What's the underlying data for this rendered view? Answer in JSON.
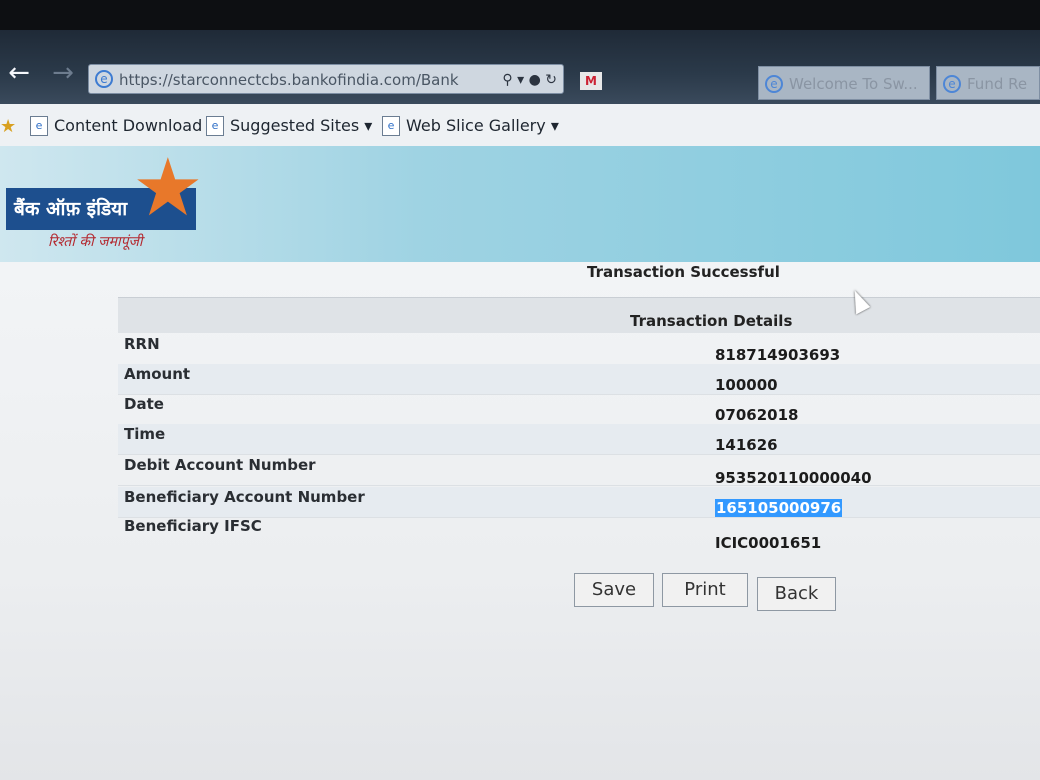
{
  "browser": {
    "url": "https://starconnectcbs.bankofindia.com/Bank",
    "tabs": [
      {
        "label": "Welcome To Sw..."
      },
      {
        "label": "Fund Re"
      }
    ],
    "favorites": [
      {
        "label": "Content Download"
      },
      {
        "label": "Suggested Sites"
      },
      {
        "label": "Web Slice Gallery"
      }
    ]
  },
  "brand": {
    "name": "बैंक ऑफ़ इंडिया",
    "tagline": "रिश्तों की जमापूंजी",
    "logo_color": "#1d4f8e",
    "star_color": "#e8782a"
  },
  "page": {
    "status": "Transaction Successful",
    "details_title": "Transaction Details",
    "rows": [
      {
        "label": "RRN",
        "value": "818714903693"
      },
      {
        "label": "Amount",
        "value": "100000"
      },
      {
        "label": "Date",
        "value": "07062018"
      },
      {
        "label": "Time",
        "value": "141626"
      },
      {
        "label": "Debit Account Number",
        "value": "953520110000040"
      },
      {
        "label": "Beneficiary Account Number",
        "value": "165105000976"
      },
      {
        "label": "Beneficiary IFSC",
        "value": "ICIC0001651"
      }
    ],
    "buttons": {
      "save": "Save",
      "print": "Print",
      "back": "Back"
    }
  }
}
